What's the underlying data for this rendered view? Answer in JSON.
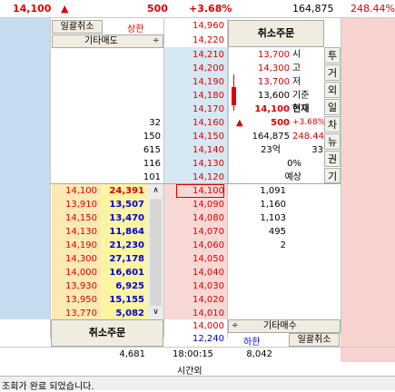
{
  "top": {
    "price": "14,100",
    "arrow": "▲",
    "change": "500",
    "rate": "+3.68%",
    "volume": "164,875",
    "vol_rate": "248.44%"
  },
  "buttons": {
    "bulk_cancel": "일괄취소",
    "cancel_order_top": "취소주문",
    "cancel_order_bottom": "취소주문",
    "other_sell": "기타매도",
    "other_buy": "기타매수",
    "bulk_cancel_bottom": "일괄취소"
  },
  "upper": {
    "label": "상한",
    "price": "14,960"
  },
  "lower": {
    "label": "하한",
    "price": "12,240"
  },
  "sell_prices": [
    "14,220",
    "14,210",
    "14,200",
    "14,190",
    "14,180",
    "14,170",
    "14,160",
    "14,150",
    "14,140",
    "14,130",
    "14,120",
    "14,110"
  ],
  "sell_qty": [
    "",
    "",
    "",
    "",
    "",
    "",
    "32",
    "150",
    "615",
    "116",
    "101"
  ],
  "buy_prices": [
    "14,100",
    "14,090",
    "14,080",
    "14,070",
    "14,060",
    "14,050",
    "14,040",
    "14,030",
    "14,020",
    "14,010",
    "14,000"
  ],
  "buy_qty": [
    "1,091",
    "1,160",
    "1,103",
    "495",
    "2",
    "",
    "",
    "",
    "",
    "",
    ""
  ],
  "ticks": [
    {
      "price": "14,100",
      "qty": "24,391"
    },
    {
      "price": "13,910",
      "qty": "13,507"
    },
    {
      "price": "14,150",
      "qty": "13,470"
    },
    {
      "price": "14,130",
      "qty": "11,864"
    },
    {
      "price": "14,190",
      "qty": "21,230"
    },
    {
      "price": "14,300",
      "qty": "27,178"
    },
    {
      "price": "14,000",
      "qty": "16,601"
    },
    {
      "price": "13,930",
      "qty": "6,925"
    },
    {
      "price": "13,950",
      "qty": "15,155"
    },
    {
      "price": "13,770",
      "qty": "5,082"
    }
  ],
  "info": [
    {
      "value": "13,700",
      "label": "시"
    },
    {
      "value": "14,300",
      "label": "고"
    },
    {
      "value": "13,700",
      "label": "저"
    },
    {
      "value": "13,600",
      "label": "기준"
    },
    {
      "value": "14,100",
      "label": "현재"
    }
  ],
  "info_change": {
    "arrow": "▲",
    "value": "500",
    "rate": "+3.68%"
  },
  "info_volume": {
    "value": "164,875",
    "rate": "248.44"
  },
  "info_amount": {
    "value": "23억",
    "extra": "33"
  },
  "info_pct": "0%",
  "info_expect": "예상",
  "side_tabs": [
    "투",
    "거",
    "외",
    "일",
    "차",
    "뉴",
    "권",
    "기"
  ],
  "footer": {
    "sell_total": "4,681",
    "time": "18:00:15",
    "buy_total": "8,042",
    "after_hours": "시간외"
  },
  "status": "조회가 완료 되었습니다."
}
